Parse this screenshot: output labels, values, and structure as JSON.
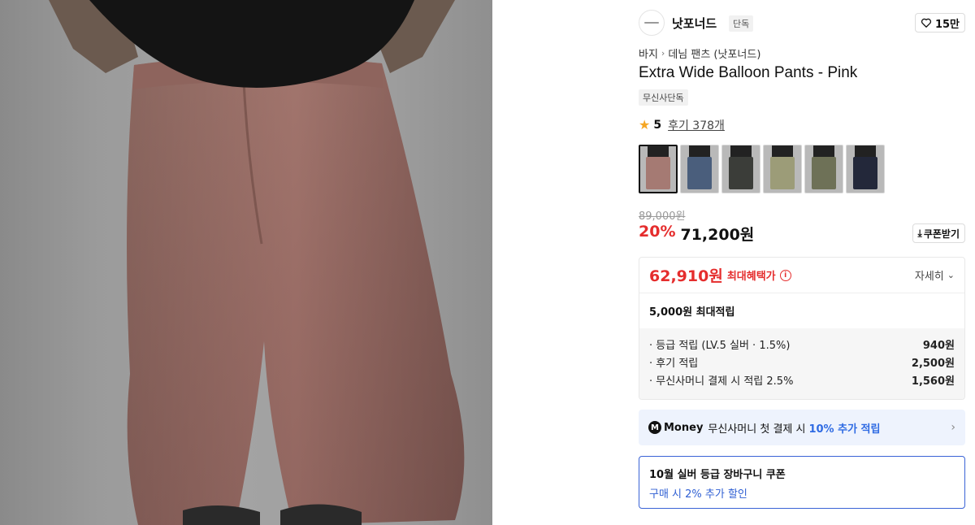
{
  "brand": {
    "name": "낫포너드",
    "badge": "단독"
  },
  "like": {
    "count": "15만"
  },
  "breadcrumb": [
    "바지",
    "데님 팬츠 (낫포너드)"
  ],
  "product": {
    "title": "Extra Wide Balloon Pants - Pink",
    "exclusive_tag": "무신사단독"
  },
  "rating": {
    "score": "5",
    "reviews": "후기 378개"
  },
  "swatches": [
    {
      "name": "pink",
      "color": "#a57a73"
    },
    {
      "name": "blue",
      "color": "#4a5e7c"
    },
    {
      "name": "black-wash",
      "color": "#3b3d39"
    },
    {
      "name": "khaki",
      "color": "#9c9c78"
    },
    {
      "name": "olive",
      "color": "#6e7157"
    },
    {
      "name": "navy",
      "color": "#23283a"
    }
  ],
  "price": {
    "original": "89,000원",
    "discount_pct": "20%",
    "sale": "71,200원",
    "coupon_label": "쿠폰받기"
  },
  "benefit": {
    "max_price": "62,910원",
    "max_label": "최대혜택가",
    "detail_label": "자세히",
    "points_title": "5,000원 최대적립",
    "lines": [
      {
        "label": "· 등급 적립 (LV.5 실버 · 1.5%)",
        "amount": "940원"
      },
      {
        "label": "· 후기 적립",
        "amount": "2,500원"
      },
      {
        "label": "· 무신사머니 결제 시 적립 2.5%",
        "amount": "1,560원"
      }
    ]
  },
  "money": {
    "logo_letter": "M",
    "logo_text": "Money",
    "text": "무신사머니 첫 결제 시",
    "highlight": "10% 추가 적립"
  },
  "coupon": {
    "title": "10월 실버 등급 장바구니 쿠폰",
    "subtitle": "구매 시 2% 추가 할인"
  },
  "colors": {
    "accent_red": "#e52d2d",
    "accent_blue": "#2f6be3",
    "pants_pink": "#a0736c"
  }
}
